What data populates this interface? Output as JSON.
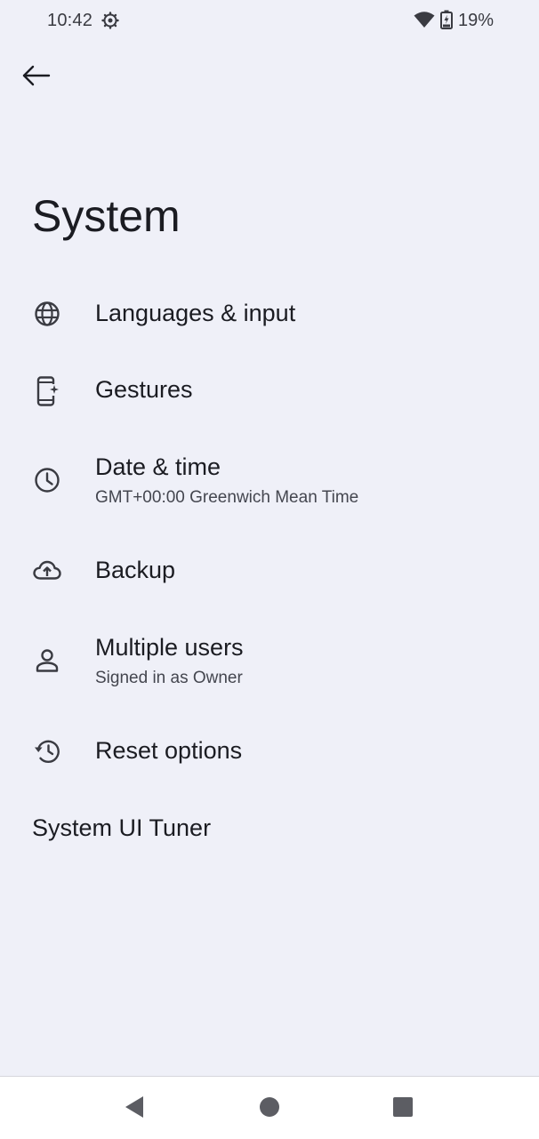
{
  "status_bar": {
    "time": "10:42",
    "battery_percent": "19%",
    "icons": [
      "settings-gear-icon",
      "wifi-icon",
      "battery-charging-icon"
    ]
  },
  "header": {
    "back_icon": "arrow-back-icon",
    "title": "System"
  },
  "items": [
    {
      "icon": "globe-icon",
      "title": "Languages & input",
      "summary": ""
    },
    {
      "icon": "phone-gesture-icon",
      "title": "Gestures",
      "summary": ""
    },
    {
      "icon": "clock-icon",
      "title": "Date & time",
      "summary": "GMT+00:00 Greenwich Mean Time"
    },
    {
      "icon": "cloud-upload-icon",
      "title": "Backup",
      "summary": ""
    },
    {
      "icon": "person-icon",
      "title": "Multiple users",
      "summary": "Signed in as Owner"
    },
    {
      "icon": "history-icon",
      "title": "Reset options",
      "summary": ""
    },
    {
      "icon": "",
      "title": "System UI Tuner",
      "summary": ""
    }
  ],
  "nav_bar": {
    "buttons": [
      "back-triangle-icon",
      "home-circle-icon",
      "recents-square-icon"
    ]
  },
  "colors": {
    "background": "#eff0f8",
    "text_primary": "#1b1c22",
    "text_secondary": "#44464f",
    "nav_background": "#ffffff"
  }
}
